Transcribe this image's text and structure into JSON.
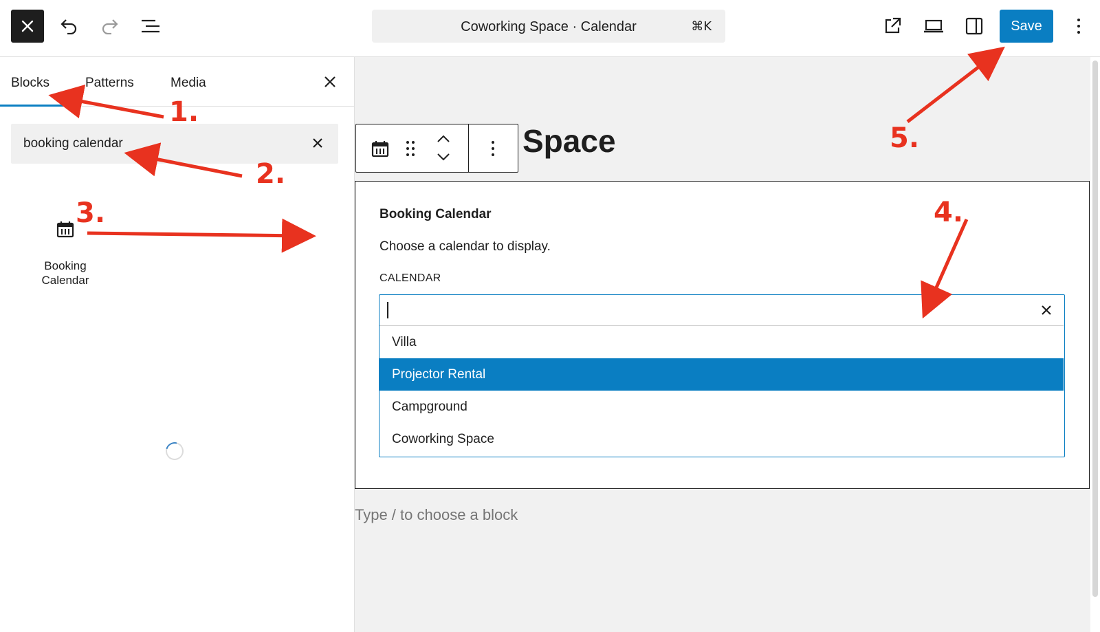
{
  "topbar": {
    "document_title": "Coworking Space · Calendar",
    "shortcut": "⌘K",
    "save_label": "Save"
  },
  "inserter": {
    "tabs": [
      {
        "label": "Blocks",
        "active": true
      },
      {
        "label": "Patterns",
        "active": false
      },
      {
        "label": "Media",
        "active": false
      }
    ],
    "search_value": "booking calendar",
    "results": [
      {
        "label": "Booking Calendar",
        "icon": "calendar-icon"
      }
    ]
  },
  "canvas": {
    "heading": "Space",
    "block": {
      "title": "Booking Calendar",
      "description": "Choose a calendar to display.",
      "field_label": "CALENDAR",
      "input_value": "",
      "options": [
        {
          "label": "Villa",
          "selected": false
        },
        {
          "label": "Projector Rental",
          "selected": true
        },
        {
          "label": "Campground",
          "selected": false
        },
        {
          "label": "Coworking Space",
          "selected": false
        }
      ]
    },
    "appender_placeholder": "Type / to choose a block"
  },
  "annotations": {
    "color": "#e8321f",
    "steps": [
      "1.",
      "2.",
      "3.",
      "4.",
      "5."
    ]
  },
  "colors": {
    "accent": "#0a7ec2",
    "dark": "#1e1e1e",
    "canvas_bg": "#f1f1f1"
  }
}
